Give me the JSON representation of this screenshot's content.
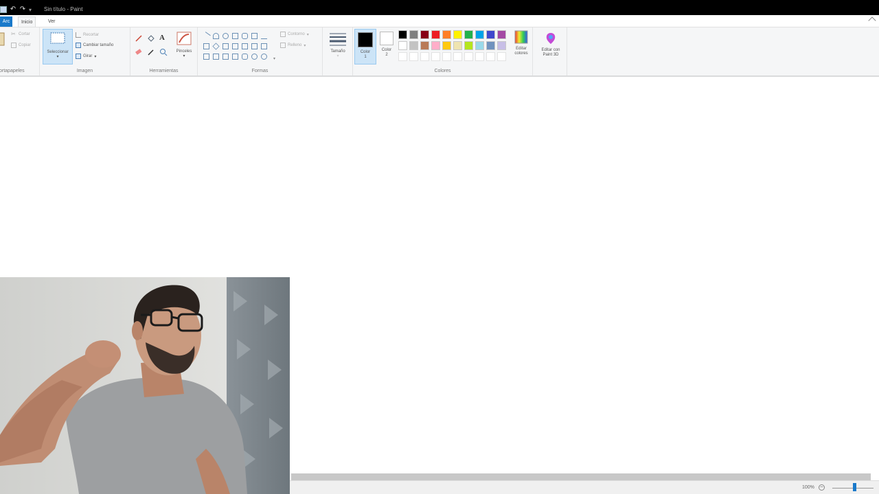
{
  "window": {
    "title": "Sin título - Paint"
  },
  "tabs": {
    "file": "Arc",
    "home": "Inicio",
    "view": "Ver"
  },
  "clipboard": {
    "paste_label": "",
    "cut_label": "Cortar",
    "copy_label": "Copiar",
    "group_label": "ortapapeles"
  },
  "image": {
    "select_label": "Seleccionar",
    "crop_label": "Recortar",
    "resize_label": "Cambiar tamaño",
    "rotate_label": "Girar",
    "group_label": "Imagen"
  },
  "tools": {
    "group_label": "Herramientas",
    "brushes_label": "Pinceles"
  },
  "shapes": {
    "outline_label": "Contorno",
    "fill_label": "Relleno",
    "group_label": "Formas"
  },
  "size": {
    "label": "Tamaño"
  },
  "colors": {
    "color1_label": "Color 1",
    "color2_label": "Color 2",
    "edit_colors_label": "Editar colores",
    "group_label": "Colores",
    "color1": "#000000",
    "color2": "#ffffff",
    "palette_row1": [
      "#000000",
      "#7f7f7f",
      "#880015",
      "#ed1c24",
      "#ff7f27",
      "#fff200",
      "#22b14c",
      "#00a2e8",
      "#3f48cc",
      "#a349a4"
    ],
    "palette_row2": [
      "#ffffff",
      "#c3c3c3",
      "#b97a57",
      "#ffaec9",
      "#ffc90e",
      "#efe4b0",
      "#b5e61d",
      "#99d9ea",
      "#7092be",
      "#c8bfe7"
    ]
  },
  "paint3d": {
    "label": "Editar con Paint 3D"
  },
  "status": {
    "zoom": "100%"
  }
}
